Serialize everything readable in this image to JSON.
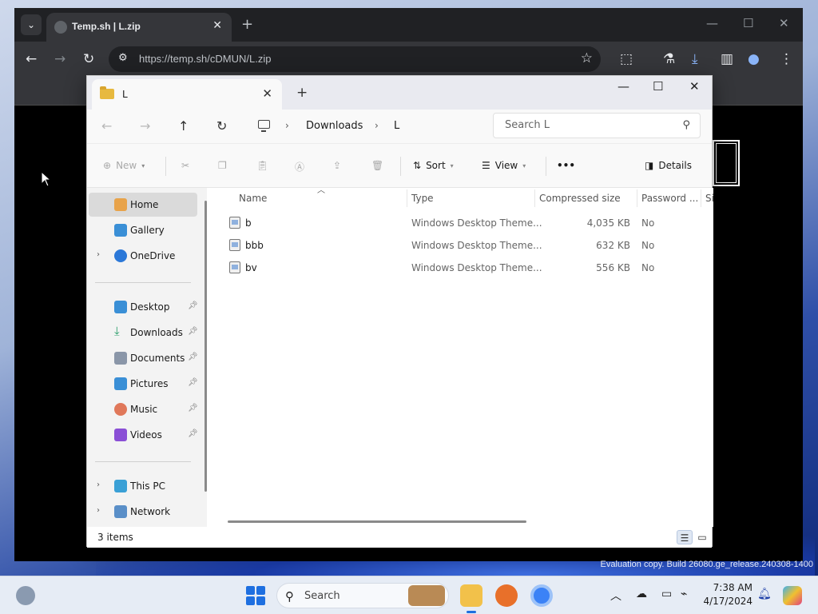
{
  "browser": {
    "tab_title": "Temp.sh | L.zip",
    "url": "https://temp.sh/cDMUN/L.zip"
  },
  "explorer": {
    "tab_title": "L",
    "breadcrumb": [
      "Downloads",
      "L"
    ],
    "search_placeholder": "Search L",
    "commands": {
      "new": "New",
      "sort": "Sort",
      "view": "View",
      "more": "•••",
      "details": "Details"
    },
    "sidebar": {
      "top": [
        {
          "label": "Home",
          "icon": "home-icon",
          "selected": true
        },
        {
          "label": "Gallery",
          "icon": "gallery-icon"
        },
        {
          "label": "OneDrive",
          "icon": "cloud-icon",
          "expandable": true
        }
      ],
      "pinned": [
        {
          "label": "Desktop",
          "icon": "desktop-icon",
          "color": "#3a8fd6"
        },
        {
          "label": "Downloads",
          "icon": "download-icon",
          "color": "#2a9d6a"
        },
        {
          "label": "Documents",
          "icon": "document-icon",
          "color": "#8a96a8"
        },
        {
          "label": "Pictures",
          "icon": "pictures-icon",
          "color": "#3a8fd6"
        },
        {
          "label": "Music",
          "icon": "music-icon",
          "color": "#e0785a"
        },
        {
          "label": "Videos",
          "icon": "videos-icon",
          "color": "#8a4fd6"
        }
      ],
      "bottom": [
        {
          "label": "This PC",
          "icon": "pc-icon"
        },
        {
          "label": "Network",
          "icon": "network-icon"
        }
      ]
    },
    "columns": [
      "Name",
      "Type",
      "Compressed size",
      "Password ...",
      "Si"
    ],
    "files": [
      {
        "name": "b",
        "type": "Windows Desktop Theme...",
        "size": "4,035 KB",
        "password": "No"
      },
      {
        "name": "bbb",
        "type": "Windows Desktop Theme...",
        "size": "632 KB",
        "password": "No"
      },
      {
        "name": "bv",
        "type": "Windows Desktop Theme...",
        "size": "556 KB",
        "password": "No"
      }
    ],
    "status": "3 items"
  },
  "watermark": "Evaluation copy. Build 26080.ge_release.240308-1400",
  "taskbar": {
    "search": "Search",
    "time": "7:38 AM",
    "date": "4/17/2024"
  },
  "colors": {
    "accent": "#1e6fe0",
    "browser_chrome": "#35363a"
  }
}
